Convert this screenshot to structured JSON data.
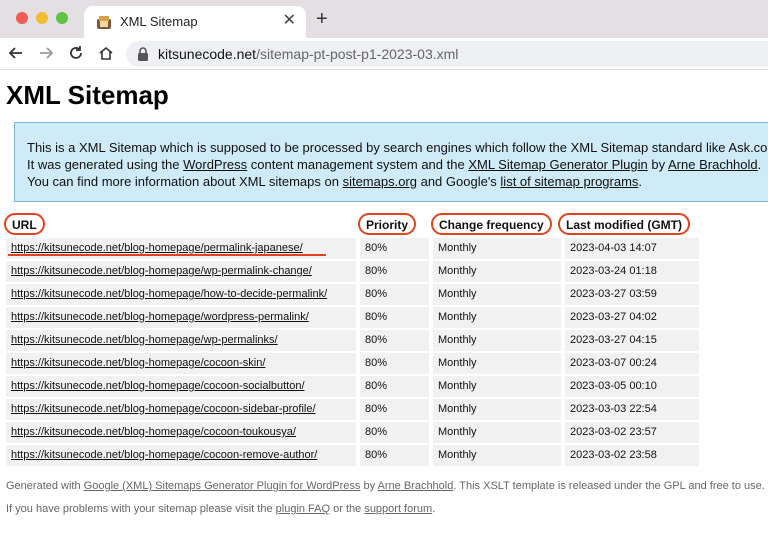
{
  "browser": {
    "tab_title": "XML Sitemap",
    "new_tab_label": "+",
    "close_label": "✕",
    "url_host": "kitsunecode.net",
    "url_path": "/sitemap-pt-post-p1-2023-03.xml",
    "icons": [
      "back-arrow-icon",
      "forward-arrow-icon",
      "reload-icon",
      "home-icon",
      "lock-icon",
      "tab-favicon-icon"
    ]
  },
  "page": {
    "title": "XML Sitemap",
    "intro": {
      "line1": "This is a XML Sitemap which is supposed to be processed by search engines which follow the XML Sitemap standard like Ask.co",
      "line2_a": "It was generated using the ",
      "line2_link1": "WordPress",
      "line2_b": " content management system and the ",
      "line2_link2": "XML Sitemap Generator Plugin",
      "line2_c": " by ",
      "line2_link3": "Arne Brachhold",
      "line2_d": ".",
      "line3_a": "You can find more information about XML sitemaps on ",
      "line3_link1": "sitemaps.org",
      "line3_b": " and Google's ",
      "line3_link2": "list of sitemap programs",
      "line3_c": "."
    },
    "table": {
      "headers": {
        "url": "URL",
        "priority": "Priority",
        "change_frequency": "Change frequency",
        "last_modified": "Last modified (GMT)"
      },
      "rows": [
        {
          "url": "https://kitsunecode.net/blog-homepage/permalink-japanese/",
          "priority": "80%",
          "freq": "Monthly",
          "modified": "2023-04-03 14:07"
        },
        {
          "url": "https://kitsunecode.net/blog-homepage/wp-permalink-change/",
          "priority": "80%",
          "freq": "Monthly",
          "modified": "2023-03-24 01:18"
        },
        {
          "url": "https://kitsunecode.net/blog-homepage/how-to-decide-permalink/",
          "priority": "80%",
          "freq": "Monthly",
          "modified": "2023-03-27 03:59"
        },
        {
          "url": "https://kitsunecode.net/blog-homepage/wordpress-permalink/",
          "priority": "80%",
          "freq": "Monthly",
          "modified": "2023-03-27 04:02"
        },
        {
          "url": "https://kitsunecode.net/blog-homepage/wp-permalinks/",
          "priority": "80%",
          "freq": "Monthly",
          "modified": "2023-03-27 04:15"
        },
        {
          "url": "https://kitsunecode.net/blog-homepage/cocoon-skin/",
          "priority": "80%",
          "freq": "Monthly",
          "modified": "2023-03-07 00:24"
        },
        {
          "url": "https://kitsunecode.net/blog-homepage/cocoon-socialbutton/",
          "priority": "80%",
          "freq": "Monthly",
          "modified": "2023-03-05 00:10"
        },
        {
          "url": "https://kitsunecode.net/blog-homepage/cocoon-sidebar-profile/",
          "priority": "80%",
          "freq": "Monthly",
          "modified": "2023-03-03 22:54"
        },
        {
          "url": "https://kitsunecode.net/blog-homepage/cocoon-toukousya/",
          "priority": "80%",
          "freq": "Monthly",
          "modified": "2023-03-02 23:57"
        },
        {
          "url": "https://kitsunecode.net/blog-homepage/cocoon-remove-author/",
          "priority": "80%",
          "freq": "Monthly",
          "modified": "2023-03-02 23:58"
        }
      ]
    },
    "footer": {
      "line1_a": "Generated with ",
      "line1_link1": "Google (XML) Sitemaps Generator Plugin for WordPress",
      "line1_b": " by ",
      "line1_link2": "Arne Brachhold",
      "line1_c": ". This XSLT template is released under the GPL and free to use.",
      "line2_a": "If you have problems with your sitemap please visit the ",
      "line2_link1": "plugin FAQ",
      "line2_b": " or the ",
      "line2_link2": "support forum",
      "line2_c": "."
    }
  },
  "colors": {
    "annotation_red": "#e0431f",
    "info_box_bg": "#cfebf7",
    "info_box_border": "#80b7d0",
    "row_bg": "#f1f1f1"
  }
}
